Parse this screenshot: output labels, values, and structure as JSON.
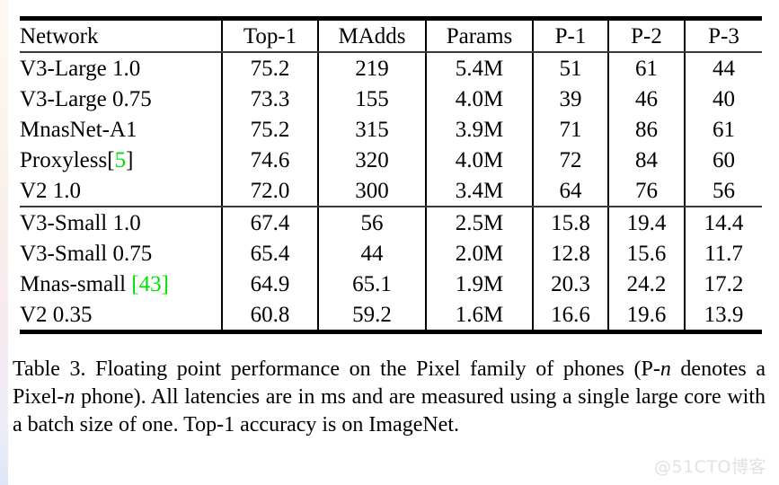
{
  "table": {
    "columns": [
      "Network",
      "Top-1",
      "MAdds",
      "Params",
      "P-1",
      "P-2",
      "P-3"
    ],
    "groups": [
      {
        "rows": [
          {
            "network": "V3-Large 1.0",
            "top1": "75.2",
            "madds": "219",
            "params": "5.4M",
            "p1": "51",
            "p2": "61",
            "p3": "44",
            "bold": true
          },
          {
            "network": "V3-Large 0.75",
            "top1": "73.3",
            "madds": "155",
            "params": "4.0M",
            "p1": "39",
            "p2": "46",
            "p3": "40",
            "bold": false
          },
          {
            "network": "MnasNet-A1",
            "top1": "75.2",
            "madds": "315",
            "params": "3.9M",
            "p1": "71",
            "p2": "86",
            "p3": "61",
            "bold": false
          },
          {
            "network": "Proxyless",
            "cite": "5",
            "cite_style": "number-only",
            "top1": "74.6",
            "madds": "320",
            "params": "4.0M",
            "p1": "72",
            "p2": "84",
            "p3": "60",
            "bold": false
          },
          {
            "network": "V2 1.0",
            "top1": "72.0",
            "madds": "300",
            "params": "3.4M",
            "p1": "64",
            "p2": "76",
            "p3": "56",
            "bold": false
          }
        ]
      },
      {
        "rows": [
          {
            "network": "V3-Small 1.0",
            "top1": "67.4",
            "madds": "56",
            "params": "2.5M",
            "p1": "15.8",
            "p2": "19.4",
            "p3": "14.4",
            "bold": true
          },
          {
            "network": "V3-Small 0.75",
            "top1": "65.4",
            "madds": "44",
            "params": "2.0M",
            "p1": "12.8",
            "p2": "15.6",
            "p3": "11.7",
            "bold": false
          },
          {
            "network": "Mnas-small ",
            "cite": "43",
            "cite_style": "full-bracket",
            "top1": "64.9",
            "madds": "65.1",
            "params": "1.9M",
            "p1": "20.3",
            "p2": "24.2",
            "p3": "17.2",
            "bold": false
          },
          {
            "network": "V2 0.35",
            "top1": "60.8",
            "madds": "59.2",
            "params": "1.6M",
            "p1": "16.6",
            "p2": "19.6",
            "p3": "13.9",
            "bold": false
          }
        ]
      }
    ]
  },
  "caption": {
    "label": "Table 3.",
    "part1": " Floating point performance on the Pixel family of phones (P-",
    "italic1": "n",
    "part2": " denotes a Pixel-",
    "italic2": "n",
    "part3": " phone).  All latencies are in ms and are measured using a single large core with a batch size of one. Top-1 accuracy is on ImageNet."
  },
  "watermark": {
    "text": "@51CTO博客"
  },
  "colors": {
    "citation_green": "#00e000",
    "rule_black": "#000000",
    "rule_thin": "#3a3a3a",
    "watermark_gray": "#e2e2e2",
    "page_background": "#ffffff"
  }
}
